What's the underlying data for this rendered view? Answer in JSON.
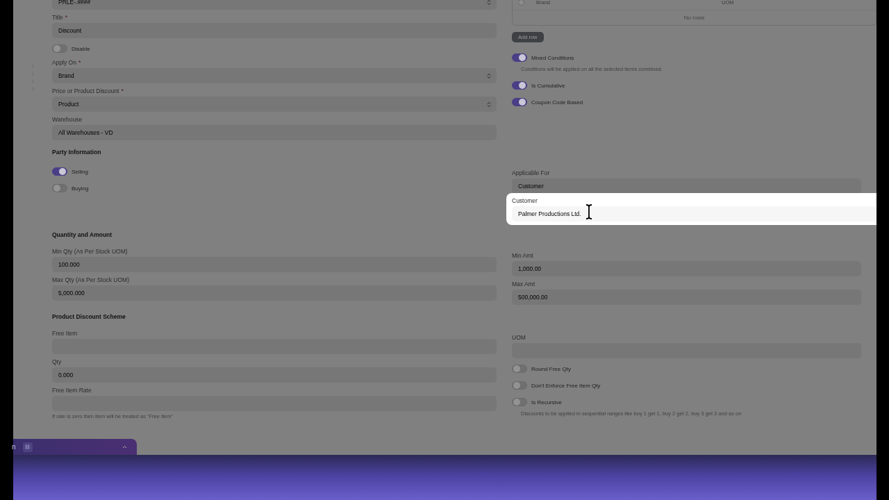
{
  "top_left": [
    {
      "kind": "select",
      "value": "PRLE-.####"
    },
    {
      "kind": "input",
      "label": "Title",
      "mark": "*",
      "value": "Discount"
    },
    {
      "kind": "toggle",
      "label": "Disable",
      "on": false
    },
    {
      "kind": "select",
      "label": "Apply On",
      "mark": "*",
      "value": "Brand"
    },
    {
      "kind": "select",
      "label": "Price or Product Discount",
      "mark": "*",
      "value": "Product"
    },
    {
      "kind": "input",
      "label": "Warehouse",
      "value": "All Warehouses - VD"
    }
  ],
  "table": {
    "checked": false,
    "columns": [
      "Brand",
      "UOM"
    ],
    "empty": "No rows"
  },
  "add_row_button": "Add row",
  "top_right": [
    {
      "kind": "toggle",
      "label": "Mixed Conditions",
      "on": true,
      "description": "Conditions will be applied on all the selected items combined."
    },
    {
      "kind": "toggle",
      "label": "Is Cumulative",
      "on": true
    },
    {
      "kind": "toggle",
      "label": "Coupon Code Based",
      "on": true
    }
  ],
  "party": {
    "heading": "Party Information",
    "left": [
      {
        "kind": "toggle",
        "label": "Selling",
        "on": true
      },
      {
        "kind": "toggle",
        "label": "Buying",
        "on": false
      }
    ],
    "right": [
      {
        "kind": "input",
        "label": "Applicable For",
        "value": "Customer"
      },
      {
        "kind": "input",
        "label": "Customer",
        "value": "Palmer Productions Ltd.",
        "highlighted": true
      }
    ]
  },
  "quantity": {
    "heading": "Quantity and Amount",
    "left": [
      {
        "kind": "input",
        "label": "Min Qty (As Per Stock UOM)",
        "value": "100.000"
      },
      {
        "kind": "input",
        "label": "Max Qty (As Per Stock UOM)",
        "value": "5,000.000"
      }
    ],
    "right": [
      {
        "kind": "input",
        "label": "Min Amt",
        "value": "1,000.00"
      },
      {
        "kind": "input",
        "label": "Max Amt",
        "value": "500,000.00"
      }
    ]
  },
  "product_discount": {
    "heading": "Product Discount Scheme",
    "left": [
      {
        "kind": "input",
        "label": "Free Item"
      },
      {
        "kind": "input",
        "label": "Qty",
        "value": "0.000"
      },
      {
        "kind": "input",
        "label": "Free Item Rate",
        "description": "If rate is zero then item will be treated as \"Free Item\""
      }
    ],
    "right": [
      {
        "kind": "input",
        "label": "UOM"
      },
      {
        "kind": "toggle",
        "label": "Round Free Qty",
        "on": false
      },
      {
        "kind": "toggle",
        "label": "Don't Enforce Free Item Qty",
        "on": false
      },
      {
        "kind": "toggle",
        "label": "Is Recursive",
        "on": false,
        "description": "Discounts to be applied in sequential ranges like buy 1 get 1, buy 2 get 2, buy 3 get 3 and so on"
      }
    ]
  },
  "dock": {
    "label": "n"
  }
}
